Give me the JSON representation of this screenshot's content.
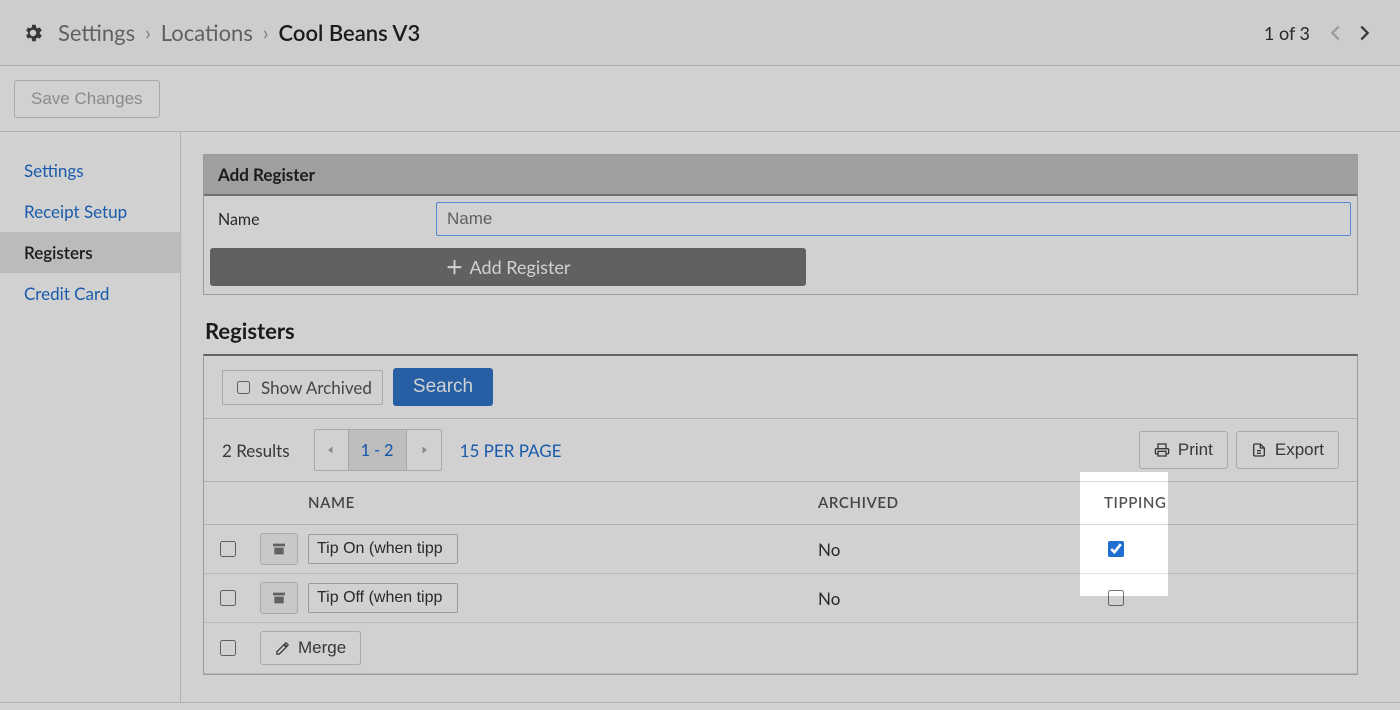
{
  "breadcrumb": {
    "root": "Settings",
    "level1": "Locations",
    "current": "Cool Beans V3",
    "pager": "1 of 3"
  },
  "actionbar": {
    "save": "Save Changes"
  },
  "sidebar": {
    "items": [
      {
        "label": "Settings"
      },
      {
        "label": "Receipt Setup"
      },
      {
        "label": "Registers"
      },
      {
        "label": "Credit Card"
      }
    ]
  },
  "add_panel": {
    "title": "Add Register",
    "name_label": "Name",
    "name_placeholder": "Name",
    "add_button": "Add Register"
  },
  "section_title": "Registers",
  "filters": {
    "show_archived": "Show Archived",
    "search": "Search"
  },
  "results": {
    "count": "2 Results",
    "range": "1 - 2",
    "per_page": "15 PER PAGE",
    "print": "Print",
    "export": "Export"
  },
  "columns": {
    "name": "NAME",
    "archived": "ARCHIVED",
    "tipping": "TIPPING"
  },
  "rows": [
    {
      "name": "Tip On (when tipp",
      "archived": "No",
      "tipping": true
    },
    {
      "name": "Tip Off (when tipp",
      "archived": "No",
      "tipping": false
    }
  ],
  "merge": {
    "label": "Merge"
  }
}
